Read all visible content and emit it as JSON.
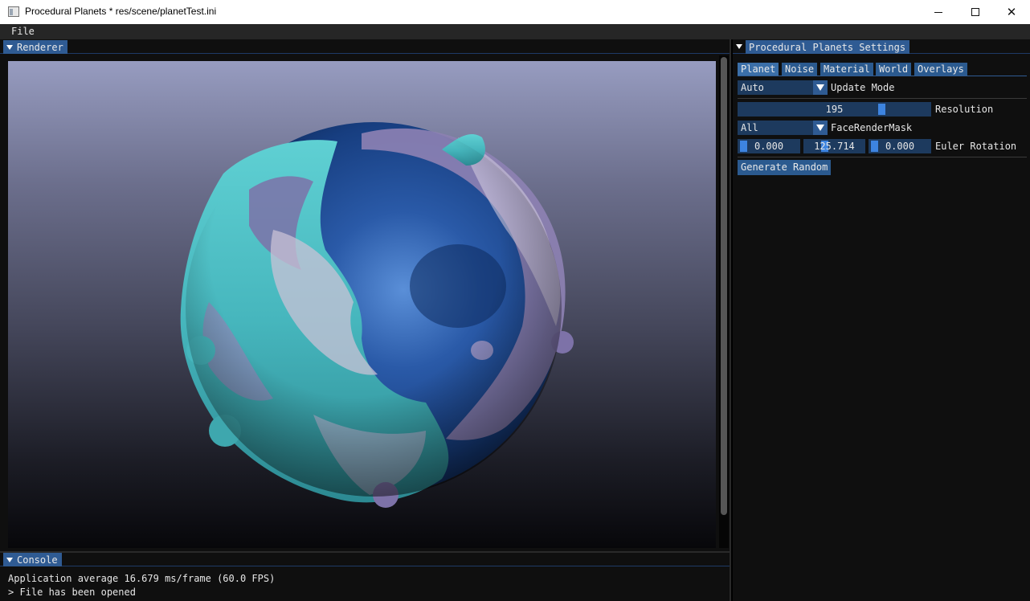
{
  "window": {
    "title": "Procedural Planets * res/scene/planetTest.ini"
  },
  "menubar": {
    "file_label": "File"
  },
  "renderer": {
    "tab_label": "Renderer"
  },
  "console": {
    "tab_label": "Console",
    "lines": [
      "Application average 16.679 ms/frame (60.0 FPS)",
      "> File has been opened"
    ]
  },
  "settings": {
    "tab_label": "Procedural Planets Settings",
    "tabs": [
      {
        "label": "Planet"
      },
      {
        "label": "Noise"
      },
      {
        "label": "Material"
      },
      {
        "label": "World"
      },
      {
        "label": "Overlays"
      }
    ],
    "update_mode": {
      "value": "Auto",
      "label": "Update Mode"
    },
    "resolution": {
      "value": "195",
      "label": "Resolution"
    },
    "face_render_mask": {
      "value": "All",
      "label": "FaceRenderMask"
    },
    "euler_rotation": {
      "label": "Euler Rotation",
      "x": "0.000",
      "y": "125.714",
      "z": "0.000"
    },
    "generate_random_label": "Generate Random"
  },
  "colors": {
    "accent": "#2f5b93",
    "slider_grab": "#3d84e0",
    "panel_bg": "#0f0f0f",
    "ocean": "#1f4f9a",
    "land": "#4fc4c8"
  }
}
